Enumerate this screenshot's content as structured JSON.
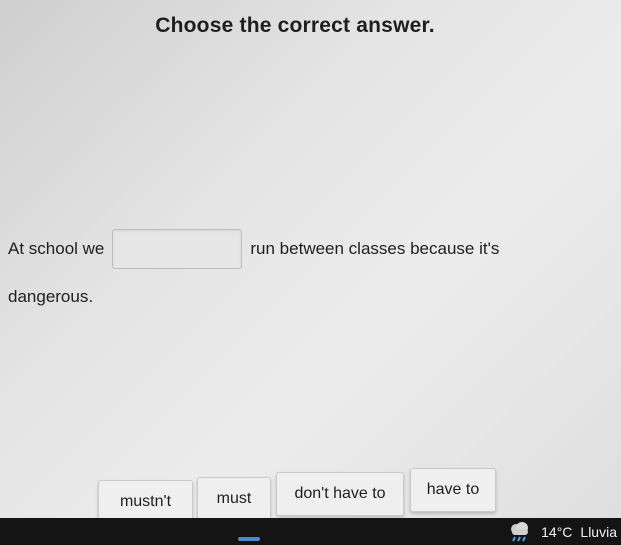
{
  "quiz": {
    "title": "Choose the correct answer.",
    "sentence_before": "At school we",
    "sentence_after": "run between classes because it's",
    "sentence_continued": "dangerous."
  },
  "options": [
    {
      "label": "mustn't"
    },
    {
      "label": "must"
    },
    {
      "label": "don't have to"
    },
    {
      "label": "have to"
    }
  ],
  "taskbar": {
    "weather_temp": "14°C",
    "weather_desc": "Lluvia",
    "weather_icon": "rain-cloud-icon"
  }
}
